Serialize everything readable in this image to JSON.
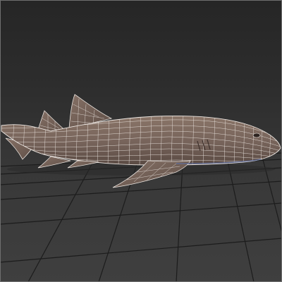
{
  "viewport": {
    "background": "#333333",
    "grid_color": "#1a1a1a",
    "model": {
      "subject": "shark",
      "display_mode": "textured-wireframe",
      "surface_color": "#7d6a60",
      "wire_color": "#e6e0dc"
    }
  }
}
